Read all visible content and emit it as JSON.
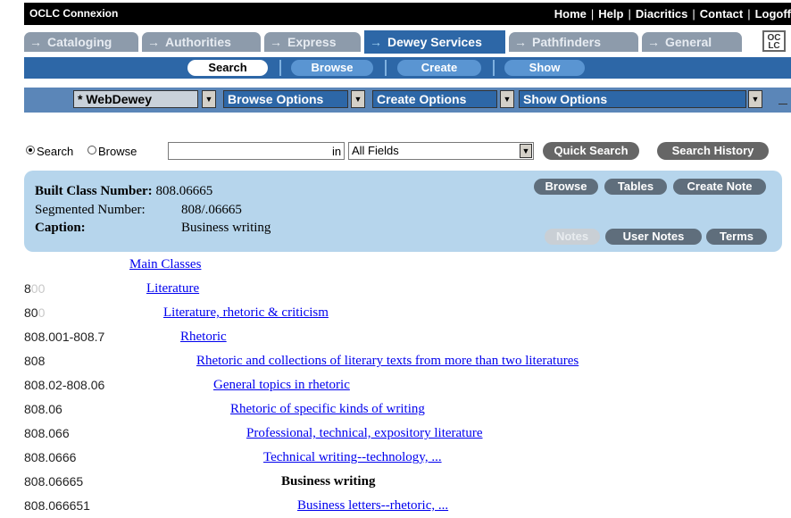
{
  "app_title": "OCLC Connexion",
  "top_links": [
    "Home",
    "Help",
    "Diacritics",
    "Contact",
    "Logoff"
  ],
  "tabs": [
    {
      "label": "Cataloging",
      "active": false
    },
    {
      "label": "Authorities",
      "active": false
    },
    {
      "label": "Express",
      "active": false
    },
    {
      "label": "Dewey Services",
      "active": true
    },
    {
      "label": "Pathfinders",
      "active": false
    },
    {
      "label": "General",
      "active": false
    }
  ],
  "logo_text": "OC LC",
  "subnav": [
    {
      "label": "Search",
      "selected": true
    },
    {
      "label": "Browse",
      "selected": false
    },
    {
      "label": "Create",
      "selected": false
    },
    {
      "label": "Show",
      "selected": false
    }
  ],
  "options": {
    "database": "* WebDewey",
    "browse": "Browse Options",
    "create": "Create Options",
    "show": "Show Options"
  },
  "search": {
    "radio_search": "Search",
    "radio_browse": "Browse",
    "query_value": "",
    "in_label": "in",
    "field": "All Fields",
    "quick_search": "Quick Search",
    "search_history": "Search History"
  },
  "record": {
    "built_label": "Built Class Number:",
    "built_value": "808.06665",
    "segmented_label": "Segmented Number:",
    "segmented_value": "808/.06665",
    "caption_label": "Caption:",
    "caption_value": "Business writing",
    "buttons": [
      "Browse",
      "Tables",
      "Create Note"
    ],
    "buttons2": [
      "Notes",
      "User Notes",
      "Terms"
    ]
  },
  "hierarchy": [
    {
      "num_dark": "",
      "num_grey": "",
      "text": "Main Classes",
      "link": true
    },
    {
      "num_dark": "8",
      "num_grey": "00",
      "text": "Literature",
      "link": true
    },
    {
      "num_dark": "80",
      "num_grey": "0",
      "text": "Literature, rhetoric & criticism",
      "link": true
    },
    {
      "num_dark": "808.001-808.7",
      "num_grey": "",
      "text": "Rhetoric",
      "link": true
    },
    {
      "num_dark": "808",
      "num_grey": "",
      "text": "Rhetoric and collections of literary texts from more than two literatures",
      "link": true
    },
    {
      "num_dark": "808.02-808.06",
      "num_grey": "",
      "text": "General topics in rhetoric",
      "link": true
    },
    {
      "num_dark": "808.06",
      "num_grey": "",
      "text": "Rhetoric of specific kinds of writing",
      "link": true
    },
    {
      "num_dark": "808.066",
      "num_grey": "",
      "text": "Professional, technical, expository literature",
      "link": true
    },
    {
      "num_dark": "808.0666",
      "num_grey": "",
      "text": "Technical writing--technology, ...",
      "link": true
    },
    {
      "num_dark": "808.06665",
      "num_grey": "",
      "text": "Business writing",
      "link": false
    },
    {
      "num_dark": "808.066651",
      "num_grey": "",
      "text": "Business letters--rhetoric, ...",
      "link": true
    }
  ]
}
